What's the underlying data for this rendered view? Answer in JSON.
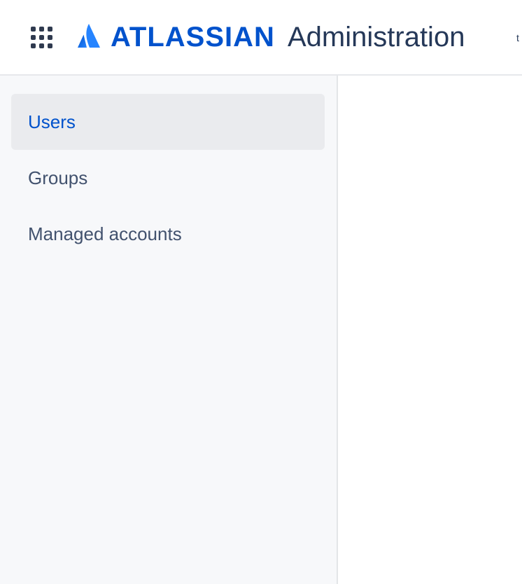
{
  "header": {
    "app_switcher_icon": "grid-dots-icon",
    "logo_icon": "atlassian-logo-icon",
    "brand_name": "ATLASSIAN",
    "product_name": "Administration",
    "brand_color": "#0052cc",
    "product_color": "#253858"
  },
  "sidebar": {
    "items": [
      {
        "label": "Users",
        "selected": true
      },
      {
        "label": "Groups",
        "selected": false
      },
      {
        "label": "Managed accounts",
        "selected": false
      }
    ],
    "selected_color": "#0052cc",
    "selected_bg": "#eaebee",
    "background": "#f7f8fa"
  }
}
